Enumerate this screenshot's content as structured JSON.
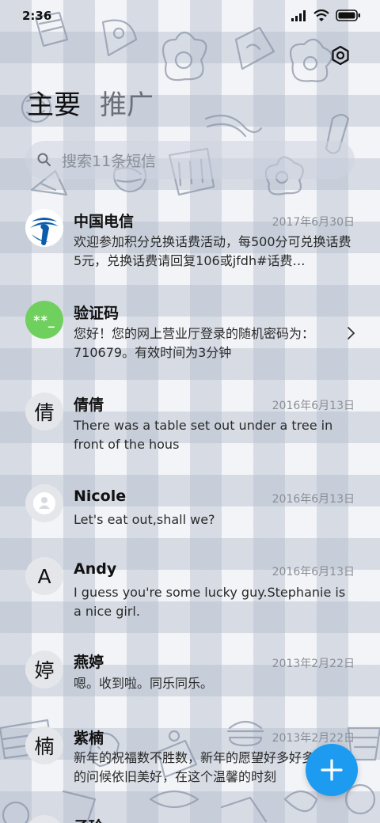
{
  "status_bar": {
    "time": "2:36"
  },
  "tabs": [
    {
      "label": "主要"
    },
    {
      "label": "推广"
    }
  ],
  "search": {
    "placeholder": "搜索11条短信"
  },
  "conversations": [
    {
      "avatar_type": "telecom-logo",
      "name": "中国电信",
      "date": "2017年6月30日",
      "preview": "欢迎参加积分兑换话费活动，每500分可兑换话费5元，兑换话费请回复106或jfdh#话费…"
    },
    {
      "avatar_type": "code",
      "avatar_text": "**_",
      "name": "验证码",
      "date": "",
      "preview": "您好！您的网上营业厅登录的随机密码为：710679。有效时间为3分钟"
    },
    {
      "avatar_type": "letter",
      "avatar_text": "倩",
      "name": "倩倩",
      "date": "2016年6月13日",
      "preview": "There was a table set out under a tree in front of the hous"
    },
    {
      "avatar_type": "person",
      "name": "Nicole",
      "date": "2016年6月13日",
      "preview": "Let's eat out,shall we?"
    },
    {
      "avatar_type": "letter",
      "avatar_text": "A",
      "name": "Andy",
      "date": "2016年6月13日",
      "preview": "I guess you're some lucky guy.Stephanie is a nice girl."
    },
    {
      "avatar_type": "letter",
      "avatar_text": "婷",
      "name": "燕婷",
      "date": "2013年2月22日",
      "preview": "嗯。收到啦。同乐同乐。"
    },
    {
      "avatar_type": "letter",
      "avatar_text": "楠",
      "name": "紫楠",
      "date": "2013年2月22日",
      "preview": "新年的祝福数不胜数，新年的愿望好多好多，新年的问候依旧美好，在这个温馨的时刻"
    },
    {
      "avatar_type": "letter",
      "avatar_text": "",
      "name": "子玲",
      "date": "",
      "preview": ""
    }
  ],
  "colors": {
    "accent": "#1d9bf0",
    "code_avatar": "#6fd05e",
    "telecom_blue": "#0b5cad"
  },
  "icons": {
    "settings": "gear-icon",
    "search": "search-icon",
    "fab": "plus-icon",
    "chevron": "chevron-right-icon",
    "person": "person-icon",
    "telecom": "china-telecom-logo"
  }
}
